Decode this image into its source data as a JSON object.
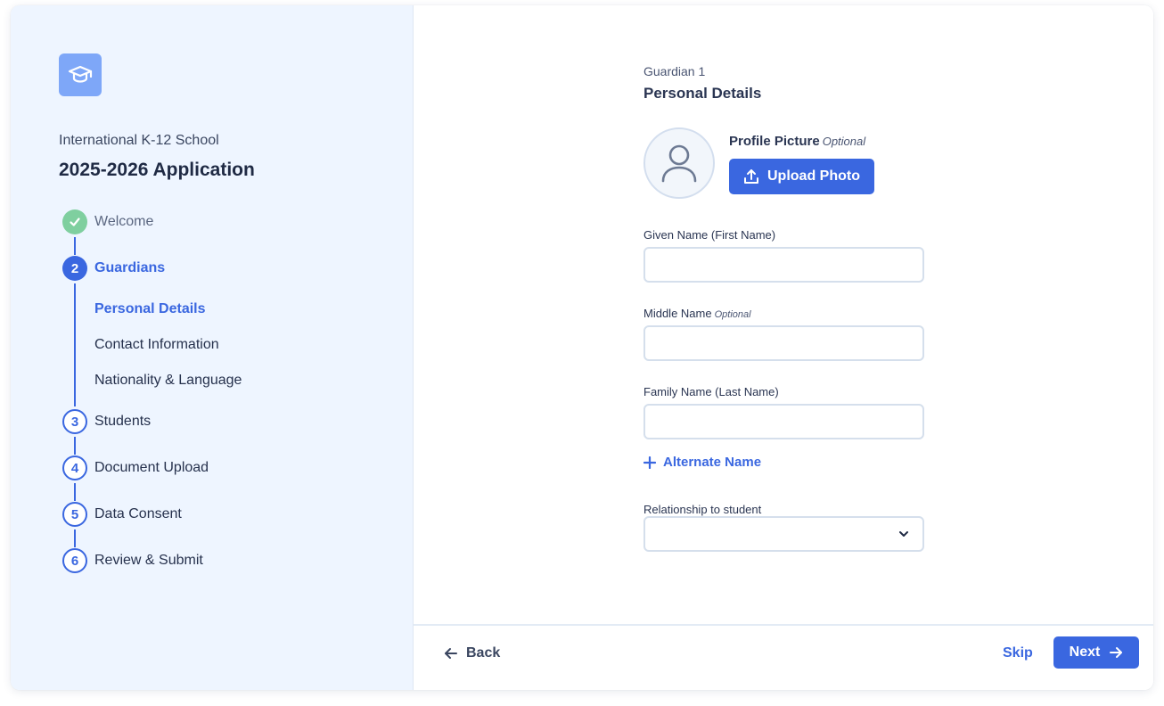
{
  "sidebar": {
    "logo_icon": "graduation-cap-icon",
    "school_name": "International K-12 School",
    "app_title": "2025-2026 Application",
    "steps": [
      {
        "number": "1",
        "label": "Welcome",
        "status": "done"
      },
      {
        "number": "2",
        "label": "Guardians",
        "status": "active"
      },
      {
        "number": "3",
        "label": "Students",
        "status": "todo"
      },
      {
        "number": "4",
        "label": "Document Upload",
        "status": "todo"
      },
      {
        "number": "5",
        "label": "Data Consent",
        "status": "todo"
      },
      {
        "number": "6",
        "label": "Review & Submit",
        "status": "todo"
      }
    ],
    "substeps": [
      {
        "label": "Personal Details",
        "active": true
      },
      {
        "label": "Contact Information",
        "active": false
      },
      {
        "label": "Nationality & Language",
        "active": false
      }
    ]
  },
  "form": {
    "kicker": "Guardian 1",
    "title": "Personal Details",
    "profile_label": "Profile Picture",
    "optional": "Optional",
    "upload_label": "Upload Photo",
    "given_name_label": "Given Name (First Name)",
    "given_name_value": "",
    "middle_name_label": "Middle Name",
    "middle_name_value": "",
    "family_name_label": "Family Name (Last Name)",
    "family_name_value": "",
    "alternate_name_label": "Alternate Name",
    "relationship_label": "Relationship to student",
    "relationship_value": ""
  },
  "footer": {
    "back_label": "Back",
    "skip_label": "Skip",
    "next_label": "Next"
  },
  "colors": {
    "accent": "#3a67e0",
    "sidebar_bg": "#eef5ff",
    "done_green": "#7fcf9f",
    "logo_bg": "#7ea7f8"
  }
}
